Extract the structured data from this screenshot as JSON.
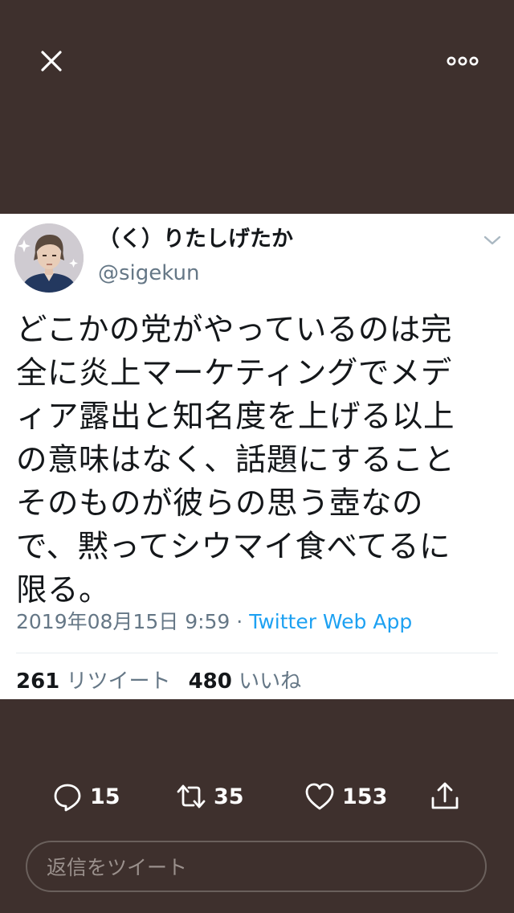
{
  "header": {
    "close_icon": "close-icon",
    "more_icon": "more-icon"
  },
  "tweet": {
    "display_name": "（く）りたしげたか",
    "handle": "@sigekun",
    "text_lines": [
      "どこかの党がやっているのは完",
      "全に炎上マーケティングでメデ",
      "ィア露出と知名度を上げる以上",
      "の意味はなく、話題にすること",
      "そのものが彼らの思う壺なの",
      "で、黙ってシウマイ食べてるに",
      "限る。"
    ],
    "timestamp": "2019年08月15日 9:59",
    "separator": " · ",
    "source": "Twitter Web App",
    "stats": {
      "retweets": "261",
      "retweets_label": "リツイート",
      "likes": "480",
      "likes_label": "いいね"
    }
  },
  "actions": {
    "reply_count": "15",
    "retweet_count": "35",
    "like_count": "153"
  },
  "reply_box": {
    "placeholder": "返信をツイート"
  },
  "colors": {
    "background": "#3e302d",
    "card": "#ffffff",
    "text": "#14171a",
    "secondary": "#657786",
    "link": "#1da1f2"
  }
}
